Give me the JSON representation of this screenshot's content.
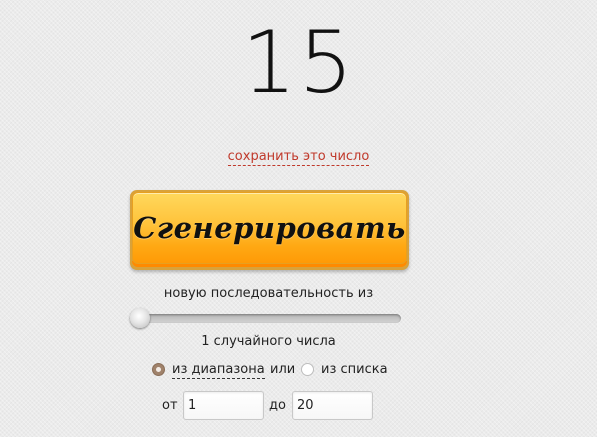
{
  "result": {
    "value": "15"
  },
  "save": {
    "label": "сохранить это число"
  },
  "generate": {
    "label": "Сгенерировать"
  },
  "sequence": {
    "label": "новую последовательность из",
    "count_label": "1 случайного числа",
    "slider_value": 1
  },
  "mode": {
    "range_label": "из диапазона",
    "or_label": "или",
    "list_label": "из списка",
    "selected": "range"
  },
  "range": {
    "from_label": "от",
    "from_value": "1",
    "to_label": "до",
    "to_value": "20"
  },
  "colors": {
    "accent_link": "#c0392b",
    "button_top": "#ffd85c",
    "button_bottom": "#ff9a06"
  }
}
